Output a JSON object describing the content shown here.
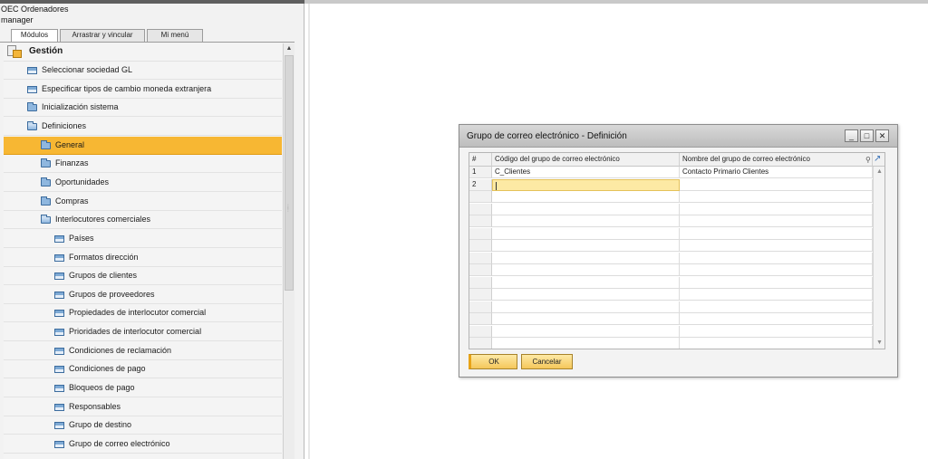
{
  "session": {
    "company": "OEC Ordenadores",
    "user": "manager"
  },
  "nav_tabs": [
    {
      "label": "Módulos"
    },
    {
      "label": "Arrastrar y vincular"
    },
    {
      "label": "Mi menú"
    }
  ],
  "tree": {
    "header": "Gestión",
    "items": [
      {
        "label": "Seleccionar sociedad GL",
        "icon": "window-icon"
      },
      {
        "label": "Especificar tipos de cambio moneda extranjera",
        "icon": "window-icon"
      },
      {
        "label": "Inicialización sistema",
        "icon": "folder-icon"
      },
      {
        "label": "Definiciones",
        "icon": "open-folder-icon"
      },
      {
        "label": "General",
        "icon": "folder-icon",
        "selected": true
      },
      {
        "label": "Finanzas",
        "icon": "folder-icon"
      },
      {
        "label": "Oportunidades",
        "icon": "folder-icon"
      },
      {
        "label": "Compras",
        "icon": "folder-icon"
      },
      {
        "label": "Interlocutores comerciales",
        "icon": "open-folder-icon"
      },
      {
        "label": "Países",
        "icon": "window-icon"
      },
      {
        "label": "Formatos dirección",
        "icon": "window-icon"
      },
      {
        "label": "Grupos de clientes",
        "icon": "window-icon"
      },
      {
        "label": "Grupos de proveedores",
        "icon": "window-icon"
      },
      {
        "label": "Propiedades de interlocutor comercial",
        "icon": "window-icon"
      },
      {
        "label": "Prioridades de interlocutor comercial",
        "icon": "window-icon"
      },
      {
        "label": "Condiciones de reclamación",
        "icon": "window-icon"
      },
      {
        "label": "Condiciones de pago",
        "icon": "window-icon"
      },
      {
        "label": "Bloqueos de pago",
        "icon": "window-icon"
      },
      {
        "label": "Responsables",
        "icon": "window-icon"
      },
      {
        "label": "Grupo de destino",
        "icon": "window-icon"
      },
      {
        "label": "Grupo de correo electrónico",
        "icon": "window-icon"
      }
    ]
  },
  "dialog": {
    "title": "Grupo de correo electrónico - Definición",
    "columns": [
      "#",
      "Código del grupo de correo electrónico",
      "Nombre del grupo de correo electrónico"
    ],
    "rows": [
      {
        "num": "1",
        "code": "C_Clientes",
        "name": "Contacto Primario Clientes"
      },
      {
        "num": "2",
        "code": "",
        "name": ""
      }
    ],
    "empty_rows": 13,
    "ok_label": "OK",
    "cancel_label": "Cancelar"
  },
  "colors": {
    "selection": "#f7b733",
    "active_cell": "#fde9a4",
    "button": "#f5c75a"
  }
}
